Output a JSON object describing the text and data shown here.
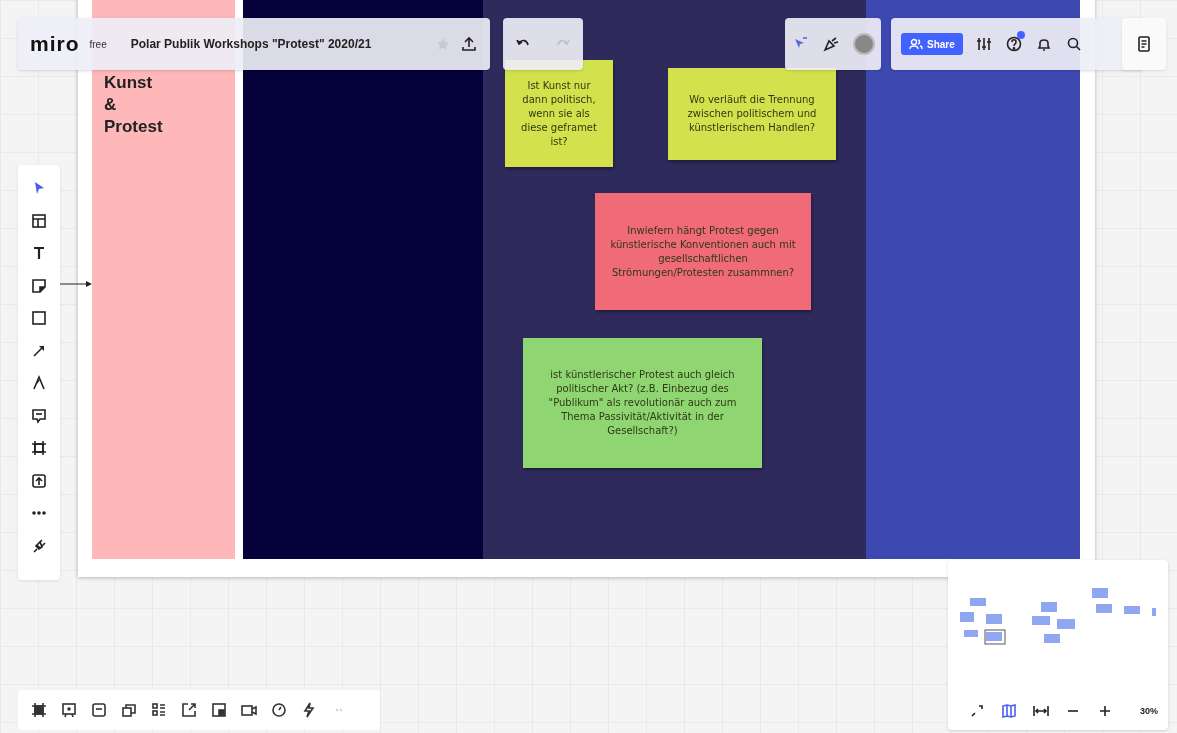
{
  "top_bar": {
    "logo": "miro",
    "plan": "free",
    "board_title": "Polar Publik Workshops \"Protest\" 2020/21",
    "share": "Share"
  },
  "board": {
    "columns": [
      {
        "color": "#ffb8ba",
        "title_lines": [
          "Kunst",
          "&",
          "Protest"
        ]
      },
      {
        "color": "#05013a"
      },
      {
        "color": "#2e2a5c"
      },
      {
        "color": "#3d49b0"
      }
    ]
  },
  "notes": [
    {
      "color": "#d3e24c",
      "text": "Ist Kunst nur dann politisch, wenn sie als diese geframet ist?"
    },
    {
      "color": "#d3e24c",
      "text": "Wo verläuft die Trennung zwischen politischem und künstlerischem Handlen?"
    },
    {
      "color": "#f06a78",
      "text": "Inwiefern hängt Protest gegen künstlerische Konventionen auch mit gesellschaftlichen Strömungen/Protesten zusammnen?"
    },
    {
      "color": "#8fd672",
      "text": "ist künstlerischer Protest auch gleich politischer Akt? (z.B. Einbezug des \"Publikum\" als revolutionär auch zum Thema Passivität/Aktivität in der Gesellschaft?)"
    }
  ],
  "left_tools": [
    {
      "selected": true
    },
    {
      "selected": false
    },
    {
      "selected": false
    },
    {
      "selected": false
    },
    {
      "selected": false
    },
    {
      "selected": false
    },
    {
      "selected": false
    },
    {
      "selected": false
    },
    {
      "selected": false
    },
    {
      "selected": false
    },
    {
      "selected": false
    },
    {
      "selected": false
    }
  ],
  "zoom": {
    "level_text": "30%"
  }
}
